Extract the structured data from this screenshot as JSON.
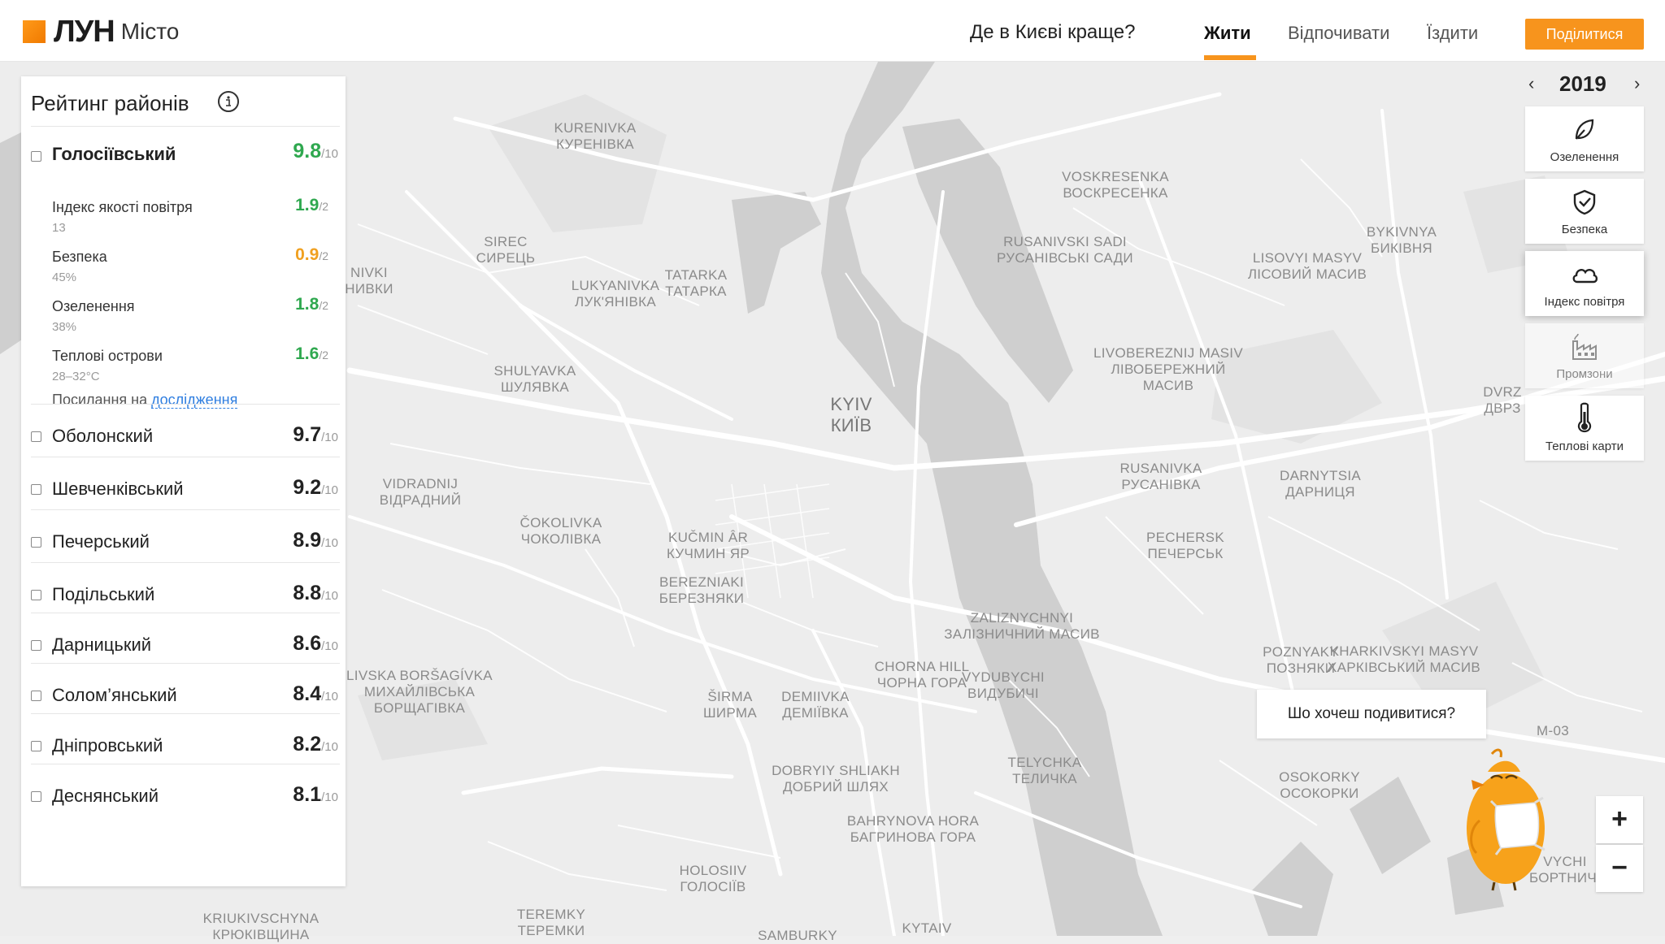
{
  "header": {
    "logo_main": "ЛУН",
    "logo_sub": "Місто",
    "question": "Де в Києві краще?",
    "tabs": [
      "Жити",
      "Відпочивати",
      "Їздити"
    ],
    "active_tab": "Жити",
    "share_label": "Поділитися",
    "accent_color": "#f7941d"
  },
  "sidebar": {
    "title": "Рейтинг районів",
    "top_district": {
      "name": "Голосіївський",
      "score": "9.8",
      "max": "/10",
      "metrics": [
        {
          "name": "Індекс якості повітря",
          "sub": "13",
          "score": "1.9",
          "max": "/2",
          "color": "green"
        },
        {
          "name": "Безпека",
          "sub": "45%",
          "score": "0.9",
          "max": "/2",
          "color": "orange"
        },
        {
          "name": "Озеленення",
          "sub": "38%",
          "score": "1.8",
          "max": "/2",
          "color": "green"
        },
        {
          "name": "Теплові острови",
          "sub": "28–32°C",
          "score": "1.6",
          "max": "/2",
          "color": "green"
        }
      ],
      "link_prefix": "Посилання на",
      "link_text": "дослідження"
    },
    "districts": [
      {
        "name": "Оболонский",
        "score": "9.7",
        "max": "/10"
      },
      {
        "name": "Шевченківський",
        "score": "9.2",
        "max": "/10"
      },
      {
        "name": "Печерський",
        "score": "8.9",
        "max": "/10"
      },
      {
        "name": "Подільський",
        "score": "8.8",
        "max": "/10"
      },
      {
        "name": "Дарницький",
        "score": "8.6",
        "max": "/10"
      },
      {
        "name": "Солом’янський",
        "score": "8.4",
        "max": "/10"
      },
      {
        "name": "Дніпровський",
        "score": "8.2",
        "max": "/10"
      },
      {
        "name": "Деснянський",
        "score": "8.1",
        "max": "/10"
      }
    ]
  },
  "year_selector": {
    "prev": "‹",
    "year": "2019",
    "next": "›"
  },
  "layers": [
    {
      "label": "Озеленення",
      "icon": "leaf-icon",
      "state": "normal"
    },
    {
      "label": "Безпека",
      "icon": "shield-check-icon",
      "state": "normal"
    },
    {
      "label": "Індекс повітря",
      "icon": "cloud-icon",
      "state": "active"
    },
    {
      "label": "Промзони",
      "icon": "factory-icon",
      "state": "dim"
    },
    {
      "label": "Теплові карти",
      "icon": "thermometer-icon",
      "state": "normal"
    }
  ],
  "tooltip": "Шо хочеш подивитися?",
  "zoom": {
    "in": "+",
    "out": "−"
  },
  "map_labels": [
    {
      "lines": [
        "KURENIVKA",
        "КУРЕНІВКА"
      ]
    },
    {
      "lines": [
        "VOSKRESENKA",
        "ВОСКРЕСЕНКА"
      ]
    },
    {
      "lines": [
        "BYKIVNYA",
        "БИКІВНЯ"
      ]
    },
    {
      "lines": [
        "RUSANIVSKI SADI",
        "РУСАНІВСЬКІ САДИ"
      ]
    },
    {
      "lines": [
        "LISOVYI MASYV",
        "ЛІСОВИЙ МАСИВ"
      ]
    },
    {
      "lines": [
        "SIREC",
        "СИРЕЦЬ"
      ]
    },
    {
      "lines": [
        "NIVKI",
        "НИВКИ"
      ]
    },
    {
      "lines": [
        "LUKYANIVKA",
        "ЛУК'ЯНІВКА"
      ]
    },
    {
      "lines": [
        "TATARKA",
        "ТАТАРКА"
      ]
    },
    {
      "lines": [
        "SHULYAVKA",
        "ШУЛЯВКА"
      ]
    },
    {
      "lines": [
        "LIVOBEREZNIJ MASIV",
        "ЛІВОБЕРЕЖНИЙ",
        "МАСИВ"
      ]
    },
    {
      "lines": [
        "KYIV",
        "КИЇВ"
      ]
    },
    {
      "lines": [
        "DVRZ",
        "ДВРЗ"
      ]
    },
    {
      "lines": [
        "VIDRADNIJ",
        "ВІДРАДНИЙ"
      ]
    },
    {
      "lines": [
        "RUSANIVKA",
        "РУСАНІВКА"
      ]
    },
    {
      "lines": [
        "DARNYTSIA",
        "ДАРНИЦЯ"
      ]
    },
    {
      "lines": [
        "ČOKOLIVKA",
        "ЧОКОЛІВКА"
      ]
    },
    {
      "lines": [
        "KUČMIN ÂR",
        "КУЧМИН ЯР"
      ]
    },
    {
      "lines": [
        "PECHERSK",
        "ПЕЧЕРСЬК"
      ]
    },
    {
      "lines": [
        "BEREZNIAKI",
        "БЕРЕЗНЯКИ"
      ]
    },
    {
      "lines": [
        "ZALIZNYCHNYI",
        "ЗАЛІЗНИЧНИЙ МАСИВ"
      ]
    },
    {
      "lines": [
        "VYDUBYCHI",
        "ВИДУБИЧІ"
      ]
    },
    {
      "lines": [
        "POZNYAKY",
        "ПОЗНЯКИ"
      ]
    },
    {
      "lines": [
        "KHARKIVSKYI MASYV",
        "ХАРКІВСЬКИЙ МАСИВ"
      ]
    },
    {
      "lines": [
        "CHORNA HILL",
        "ЧОРНА ГОРА"
      ]
    },
    {
      "lines": [
        "LIVSKA BORŠAGÍVKA",
        "МИХАЙЛІВСЬКА",
        "БОРЩАГІВКА"
      ]
    },
    {
      "lines": [
        "ŠIRMA",
        "ШИРМА"
      ]
    },
    {
      "lines": [
        "DEMIIVKA",
        "ДЕМІЇВКА"
      ]
    },
    {
      "lines": [
        "TELYCHKA",
        "ТЕЛИЧКА"
      ]
    },
    {
      "lines": [
        "OSOKORKY",
        "ОСОКОРКИ"
      ]
    },
    {
      "lines": [
        "M-03"
      ]
    },
    {
      "lines": [
        "DOBRYIY SHLIAKH",
        "ДОБРИЙ ШЛЯХ"
      ]
    },
    {
      "lines": [
        "BAHRYNOVA HORA",
        "БАГРИНОВА ГОРА"
      ]
    },
    {
      "lines": [
        "HOLOSIIV",
        "ГОЛОСІЇВ"
      ]
    },
    {
      "lines": [
        "KRIUKIVSCHYNA",
        "КРЮКІВЩИНА"
      ]
    },
    {
      "lines": [
        "TEREMKY",
        "ТЕРЕМКИ"
      ]
    },
    {
      "lines": [
        "SAMBURKY"
      ]
    },
    {
      "lines": [
        "KYTAIV"
      ]
    },
    {
      "lines": [
        "VYCHI",
        "БОРТНИЧІ"
      ]
    }
  ]
}
